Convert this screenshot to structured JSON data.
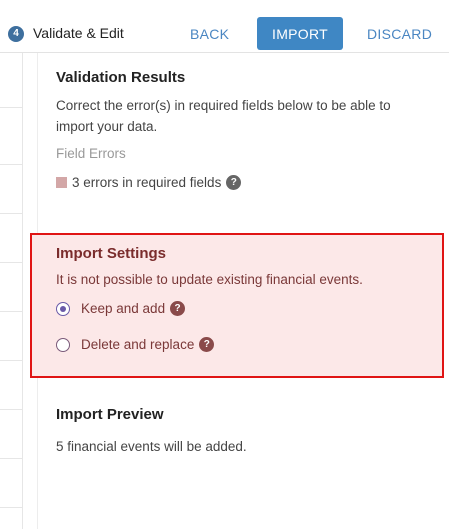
{
  "header": {
    "step_number": "4",
    "step_title": "Validate & Edit",
    "back_label": "BACK",
    "import_label": "IMPORT",
    "discard_label": "DISCARD"
  },
  "validation": {
    "title": "Validation Results",
    "description_line1": "Correct the error(s) in required fields below to be able to",
    "description_line2": "import your data.",
    "field_errors_label": "Field Errors",
    "error_summary": "3 errors in required fields",
    "help_glyph": "?"
  },
  "import_settings": {
    "title": "Import Settings",
    "note": "It is not possible to update existing financial events.",
    "options": [
      {
        "label": "Keep and add",
        "selected": true
      },
      {
        "label": "Delete and replace",
        "selected": false
      }
    ],
    "help_glyph": "?"
  },
  "preview": {
    "title": "Import Preview",
    "summary": "5 financial events will be added."
  },
  "colors": {
    "accent": "#3f87c4",
    "error_border": "#e01414",
    "error_bg": "#fce8e8",
    "error_text": "#7a2c2c"
  }
}
